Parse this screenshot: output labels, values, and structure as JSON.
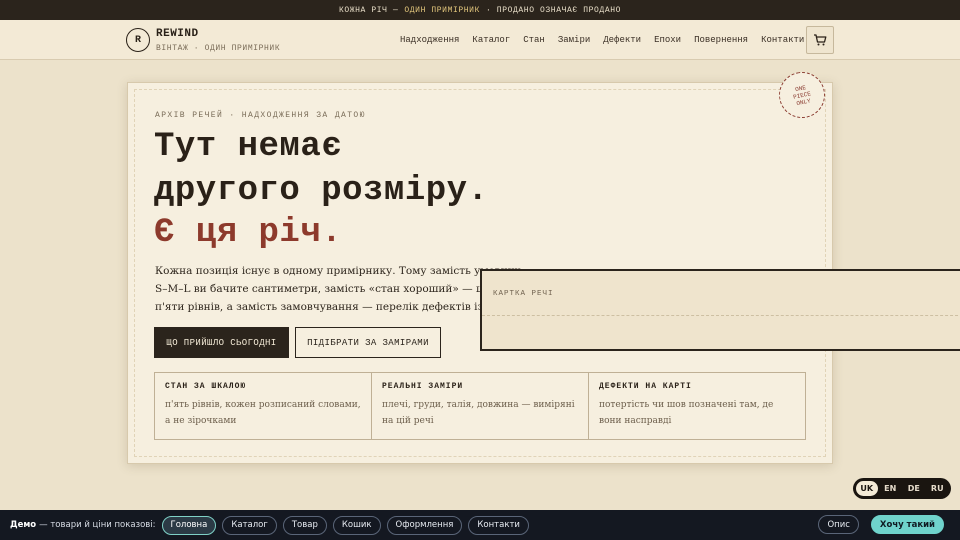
{
  "topbar": {
    "part1": "КОЖНА РІЧ —",
    "highlight": "ОДИН ПРИМІРНИК",
    "part2": "· ПРОДАНО ОЗНАЧАЄ ПРОДАНО"
  },
  "header": {
    "logo_letter": "R",
    "brand": "REWIND",
    "tagline": "ВІНТАЖ · ОДИН ПРИМІРНИК",
    "nav": [
      "Надходження",
      "Каталог",
      "Стан",
      "Заміри",
      "Дефекти",
      "Епохи",
      "Повернення",
      "Контакти"
    ],
    "cart_icon": "cart-icon"
  },
  "hero": {
    "stamp": [
      "ONE",
      "PIECE",
      "ONLY"
    ],
    "eyebrow": "АРХІВ РЕЧЕЙ · НАДХОДЖЕННЯ ЗА ДАТОЮ",
    "title_line1": "Тут немає",
    "title_line2": "другого розміру.",
    "title_line3": "Є ця річ.",
    "lead": "Кожна позиція існує в одному примірнику. Тому замість умовних S–M–L ви бачите сантиметри, замість «стан хороший» — шкалу з п'яти рівнів, а замість замовчування — перелік дефектів із позначками на самій речі.",
    "primary_button": "ЩО ПРИЙШЛО СЬОГОДНІ",
    "secondary_button": "ПІДІБРАТИ ЗА ЗАМІРАМИ",
    "features": [
      {
        "title": "СТАН ЗА ШКАЛОЮ",
        "text": "п'ять рівнів, кожен розписаний словами, а не зірочками"
      },
      {
        "title": "РЕАЛЬНІ ЗАМІРИ",
        "text": "плечі, груди, талія, довжина — виміряні на цій речі"
      },
      {
        "title": "ДЕФЕКТИ НА КАРТІ",
        "text": "потертість чи шов позначені там, де вони насправді"
      }
    ]
  },
  "panel": {
    "label": "КАРТКА РЕЧІ"
  },
  "languages": {
    "items": [
      "UK",
      "EN",
      "DE",
      "RU"
    ],
    "active": "UK"
  },
  "demobar": {
    "label": "Демо",
    "caption": "— товари й ціни показові:",
    "links": [
      "Головна",
      "Каталог",
      "Товар",
      "Кошик",
      "Оформлення",
      "Контакти"
    ],
    "active_link": "Головна",
    "description_button": "Опис",
    "cta_button": "Хочу такий"
  }
}
